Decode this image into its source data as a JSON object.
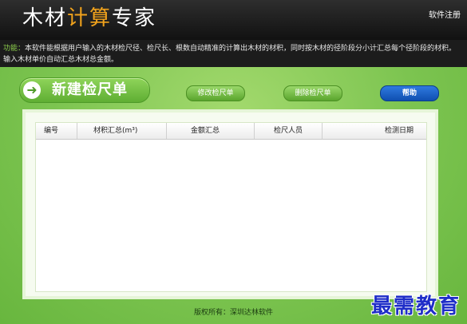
{
  "header": {
    "title_part1": "木材",
    "title_part2": "计算",
    "title_part3": "专家",
    "register_link": "软件注册"
  },
  "description": {
    "label": "功能：",
    "text": "本软件能根据用户输入的木材检尺径、检尺长、根数自动精准的计算出木材的材积，同时按木材的径阶段分小计汇总每个径阶段的材积。输入木材单价自动汇总木材总金额。"
  },
  "toolbar": {
    "new_label": "新建检尺单",
    "edit_label": "修改检尺单",
    "delete_label": "删除检尺单",
    "help_label": "帮助"
  },
  "table": {
    "columns": [
      "编号",
      "材积汇总(m³)",
      "金额汇总",
      "检尺人员",
      "检测日期"
    ],
    "rows": []
  },
  "footer": {
    "copyright": "版权所有：深圳达林软件"
  },
  "watermark": "最需教育",
  "colors": {
    "accent_orange": "#f0a21c",
    "main_green": "#7cc450",
    "help_blue": "#1a5fc8"
  }
}
